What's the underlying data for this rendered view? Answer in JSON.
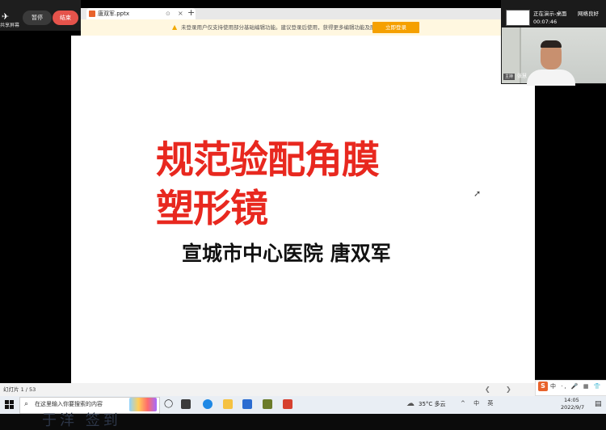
{
  "meeting": {
    "share_label": "共享屏幕",
    "pause_label": "暂停",
    "end_label": "结束"
  },
  "browser": {
    "tab_title": "唐双军.pptx",
    "new_tab": "+",
    "notice_text": "未登录用户仅支持使用部分基础编辑功能。建议登录后使用，获得更多编辑功能及服务。",
    "login_label": "立即登录"
  },
  "slide": {
    "title_line1": "规范验配角膜",
    "title_line2": "塑形镜",
    "subtitle": "宣城市中心医院   唐双军",
    "title_color": "#e8281f"
  },
  "status_bar": {
    "page_indicator": "幻灯片 1 / 53",
    "ime_items": "中 ·, 🎤 ▦ 👕 ⚙"
  },
  "camera": {
    "present_status": "正在演示-桌面",
    "present_timer": "00:07:46",
    "signal": "网络良好",
    "name_tag": "主持",
    "name": "张慧"
  },
  "taskbar": {
    "search_placeholder": "在这里输入你要搜索的内容",
    "weather": "35°C 多云",
    "tray": "^ 中 英",
    "time": "14:05",
    "date": "2022/9/7"
  },
  "watermark": {
    "text": "于洋 签到"
  }
}
